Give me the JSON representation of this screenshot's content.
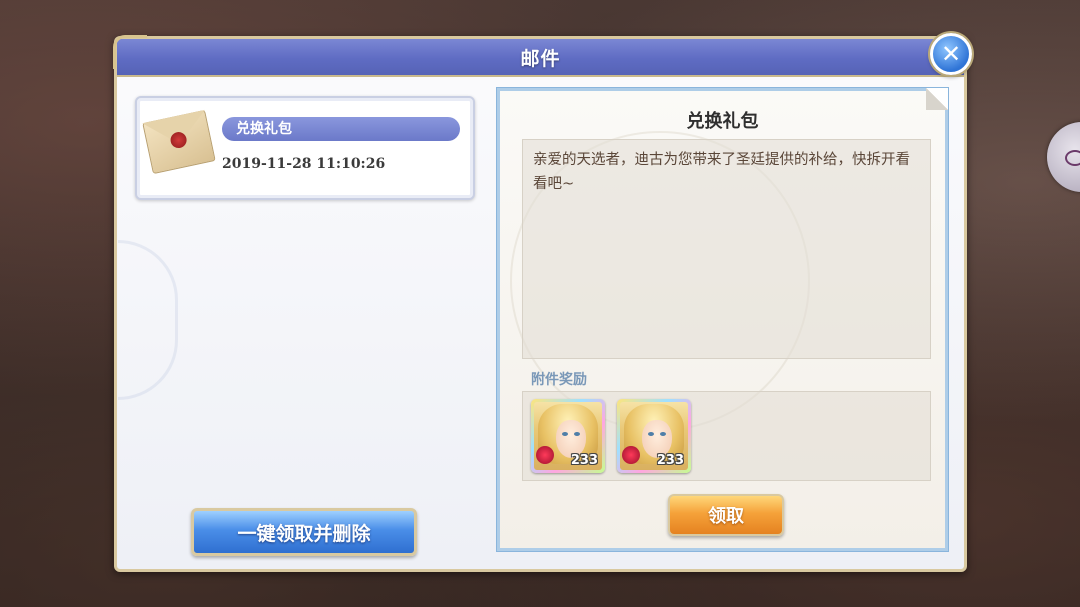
{
  "dialog": {
    "title": "邮件"
  },
  "mail_list": [
    {
      "title": "兑换礼包",
      "datetime": "2019-11-28  11:10:26",
      "icon": "envelope-icon"
    }
  ],
  "claim_all_button": "一键领取并删除",
  "letter": {
    "title": "兑换礼包",
    "body": "亲爱的天选者，迪古为您带来了圣廷提供的补给，快拆开看看吧~",
    "attachments_label": "附件奖励",
    "attachments": [
      {
        "icon": "character-portrait-icon",
        "count": "233"
      },
      {
        "icon": "character-portrait-icon",
        "count": "233"
      }
    ],
    "claim_button": "领取"
  },
  "colors": {
    "title_bar": "#6b78c8",
    "claim_button": "#f5a23a",
    "claim_all_button": "#4a8ee8",
    "frame_gold": "#d9c9a0"
  }
}
